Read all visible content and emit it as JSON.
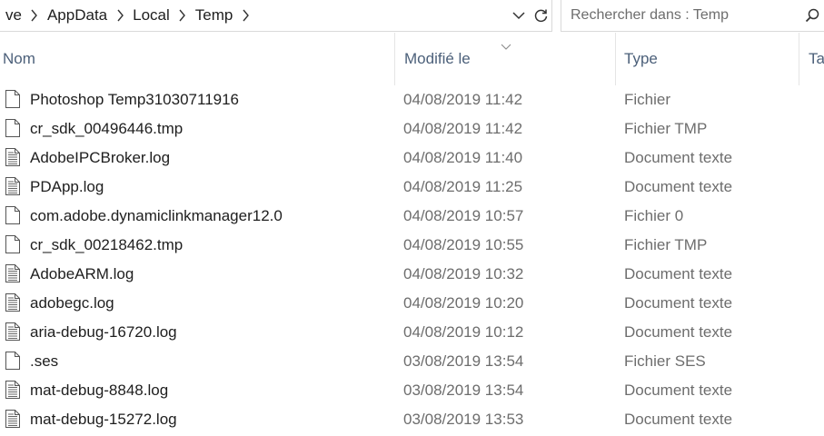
{
  "breadcrumb": {
    "items": [
      "ve",
      "AppData",
      "Local",
      "Temp"
    ]
  },
  "search": {
    "placeholder": "Rechercher dans : Temp"
  },
  "columns": {
    "name": "Nom",
    "date": "Modifié le",
    "type": "Type",
    "size": "Ta"
  },
  "files": [
    {
      "name": "Photoshop Temp31030711916",
      "date": "04/08/2019 11:42",
      "type": "Fichier",
      "icon": "blank-file-icon"
    },
    {
      "name": "cr_sdk_00496446.tmp",
      "date": "04/08/2019 11:42",
      "type": "Fichier TMP",
      "icon": "blank-file-icon"
    },
    {
      "name": "AdobeIPCBroker.log",
      "date": "04/08/2019 11:40",
      "type": "Document texte",
      "icon": "text-file-icon"
    },
    {
      "name": "PDApp.log",
      "date": "04/08/2019 11:25",
      "type": "Document texte",
      "icon": "text-file-icon"
    },
    {
      "name": "com.adobe.dynamiclinkmanager12.0",
      "date": "04/08/2019 10:57",
      "type": "Fichier 0",
      "icon": "blank-file-icon"
    },
    {
      "name": "cr_sdk_00218462.tmp",
      "date": "04/08/2019 10:55",
      "type": "Fichier TMP",
      "icon": "blank-file-icon"
    },
    {
      "name": "AdobeARM.log",
      "date": "04/08/2019 10:32",
      "type": "Document texte",
      "icon": "text-file-icon"
    },
    {
      "name": "adobegc.log",
      "date": "04/08/2019 10:20",
      "type": "Document texte",
      "icon": "text-file-icon"
    },
    {
      "name": "aria-debug-16720.log",
      "date": "04/08/2019 10:12",
      "type": "Document texte",
      "icon": "text-file-icon"
    },
    {
      "name": ".ses",
      "date": "03/08/2019 13:54",
      "type": "Fichier SES",
      "icon": "blank-file-icon"
    },
    {
      "name": "mat-debug-8848.log",
      "date": "03/08/2019 13:54",
      "type": "Document texte",
      "icon": "text-file-icon"
    },
    {
      "name": "mat-debug-15272.log",
      "date": "03/08/2019 13:53",
      "type": "Document texte",
      "icon": "text-file-icon"
    }
  ]
}
